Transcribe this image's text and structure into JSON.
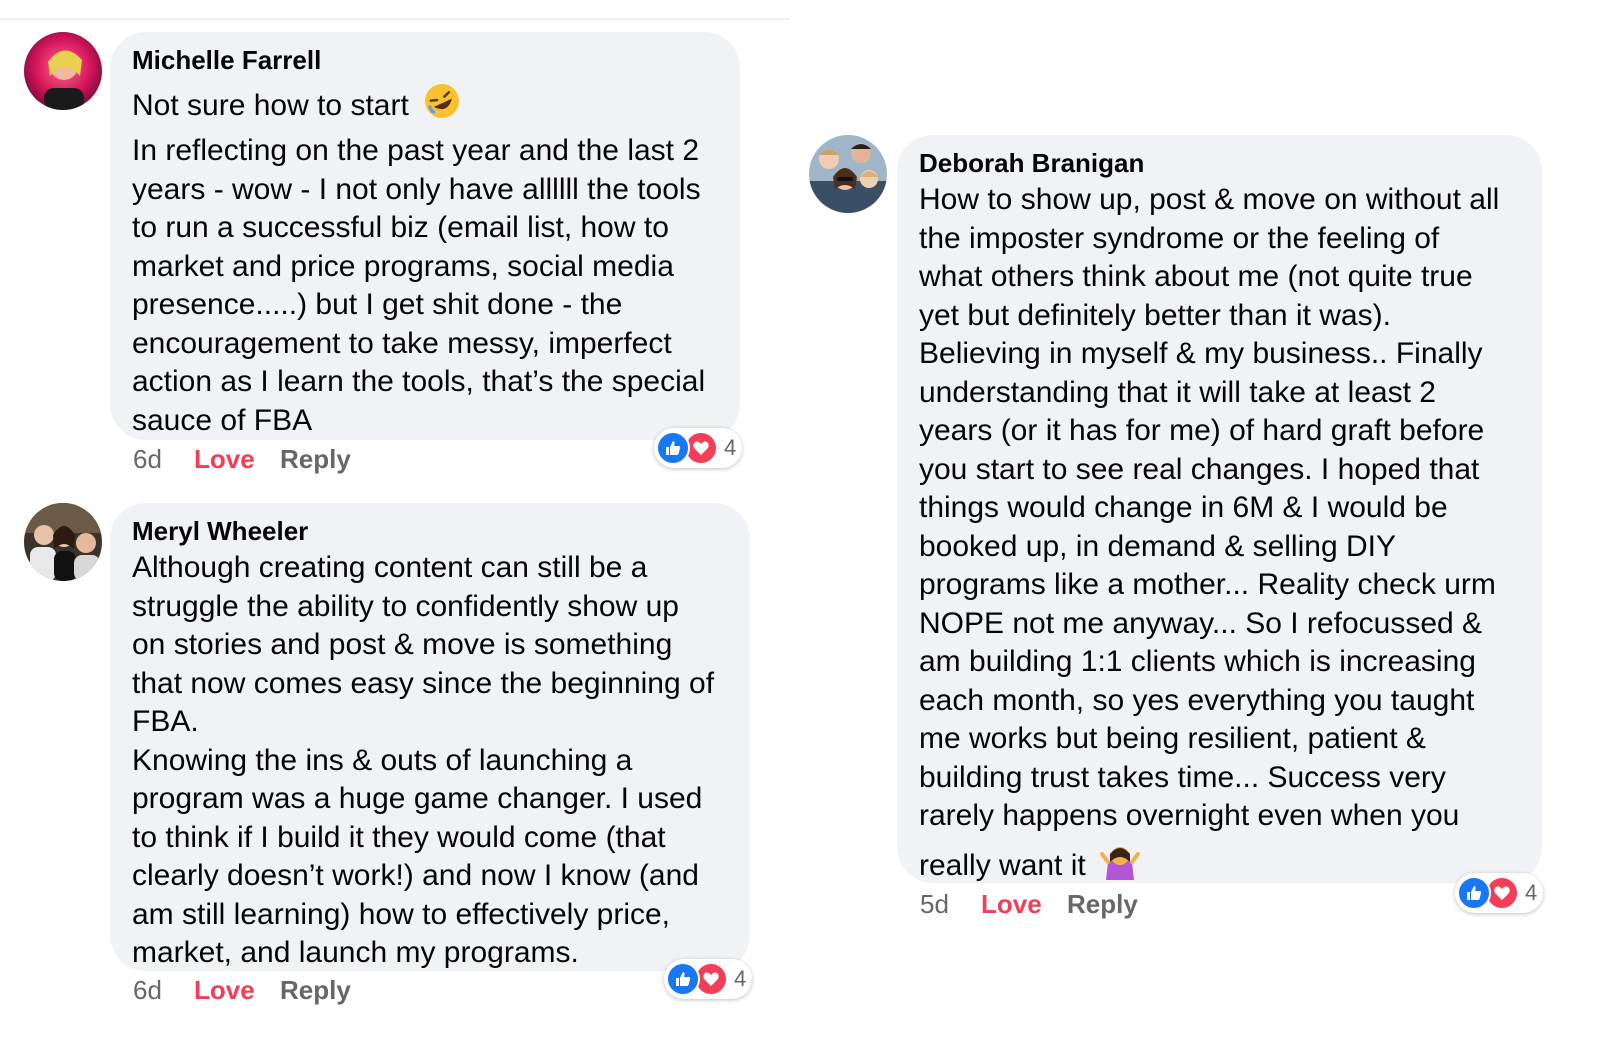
{
  "colors": {
    "bubble": "#f0f2f5",
    "love": "#f33e58",
    "meta": "#65676b",
    "like": "#1877f2"
  },
  "comments": [
    {
      "author": "Michelle Farrell",
      "first_line": "Not sure how to start",
      "first_line_emoji": "rolling-on-floor-laughing-emoji",
      "text": "In reflecting on the past year and the last 2\nyears - wow - I not only have allllll the tools\nto run a successful biz (email list, how to\nmarket and price programs, social media\npresence.....) but I get shit done - the\nencouragement to take messy, imperfect\naction as I learn the tools, that’s the special\nsauce of FBA",
      "time": "6d",
      "love": "Love",
      "reply": "Reply",
      "reaction_count": "4"
    },
    {
      "author": "Meryl Wheeler",
      "text": "Although creating content can still be a\nstruggle the ability to confidently show up\non stories and post & move is something\nthat now comes easy since the beginning of\nFBA.\nKnowing the ins & outs of launching a\nprogram was a huge game changer. I used\nto think if I build it they would come (that\nclearly doesn’t work!) and now I know (and\nam still learning) how to effectively price,\nmarket, and launch my programs.",
      "time": "6d",
      "love": "Love",
      "reply": "Reply",
      "reaction_count": "4"
    },
    {
      "author": "Deborah Branigan",
      "text": "How to show up, post & move on without all\nthe imposter syndrome or the feeling of\nwhat others think about me (not quite true\nyet but definitely better than it was).\nBelieving in myself & my business.. Finally\nunderstanding that it will take at least 2\nyears (or it has for me) of hard graft before\nyou start to see real changes. I hoped that\nthings would change in 6M & I would be\nbooked up, in demand & selling DIY\nprograms like a mother... Reality check urm\nNOPE not me anyway... So I refocussed &\nam building 1:1 clients which is increasing\neach month, so yes everything you taught\nme works but being resilient, patient &\nbuilding trust takes time... Success very\nrarely happens overnight even when you",
      "last_line": "really want it",
      "last_line_emoji": "person-shrugging-emoji",
      "time": "5d",
      "love": "Love",
      "reply": "Reply",
      "reaction_count": "4"
    }
  ]
}
